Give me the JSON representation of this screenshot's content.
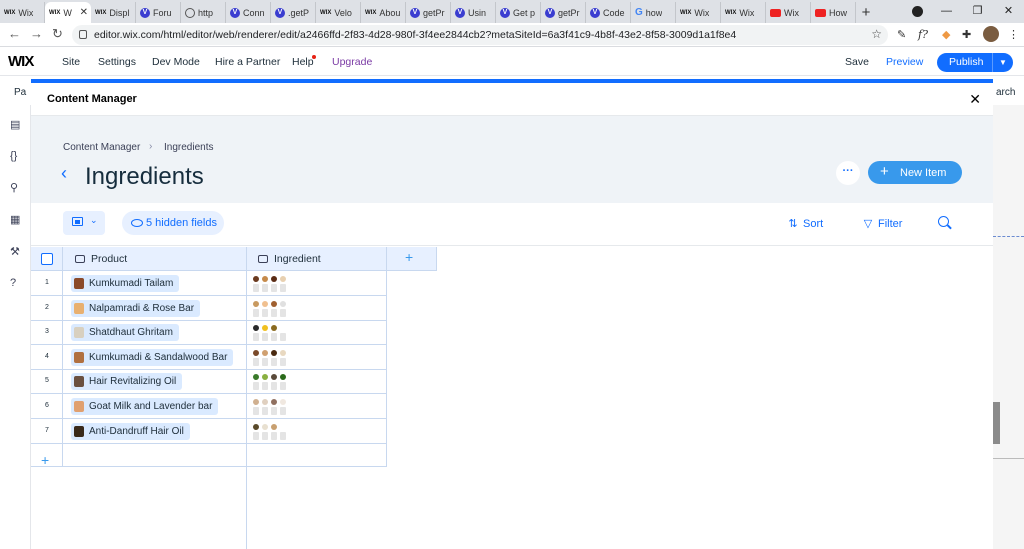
{
  "browser": {
    "tabs": [
      {
        "icon": "wix",
        "label": "Wix"
      },
      {
        "icon": "wix",
        "label": "W",
        "active": true
      },
      {
        "icon": "wix",
        "label": "Displ"
      },
      {
        "icon": "velo",
        "label": "Foru"
      },
      {
        "icon": "globe",
        "label": "http"
      },
      {
        "icon": "velo",
        "label": "Conn"
      },
      {
        "icon": "velo",
        "label": ".getP"
      },
      {
        "icon": "wix",
        "label": "Velo"
      },
      {
        "icon": "wix",
        "label": "Abou"
      },
      {
        "icon": "velo",
        "label": "getPr"
      },
      {
        "icon": "velo",
        "label": "Usin"
      },
      {
        "icon": "velo",
        "label": "Get p"
      },
      {
        "icon": "velo",
        "label": "getPr"
      },
      {
        "icon": "velo",
        "label": "Code"
      },
      {
        "icon": "google",
        "label": "how"
      },
      {
        "icon": "wix",
        "label": "Wix"
      },
      {
        "icon": "wix",
        "label": "Wix"
      },
      {
        "icon": "youtube",
        "label": "Wix"
      },
      {
        "icon": "youtube",
        "label": "How"
      }
    ],
    "url": "editor.wix.com/html/editor/web/renderer/edit/a2466ffd-2f83-4d28-980f-3f4ee2844cb2?metaSiteId=6a3f41c9-4b8f-43e2-8f58-3009d1a1f8e4",
    "accent": "#116dff"
  },
  "editor": {
    "logo": "WIX",
    "menu": [
      "Site",
      "Settings",
      "Dev Mode",
      "Hire a Partner",
      "Help",
      "Upgrade"
    ],
    "save": "Save",
    "preview": "Preview",
    "publish": "Publish",
    "sub_left": "Pa",
    "sub_right": "arch"
  },
  "modal": {
    "title": "Content Manager",
    "breadcrumb": [
      "Content Manager",
      "Ingredients"
    ],
    "page_title": "Ingredients",
    "more": "···",
    "new_item": "New Item",
    "hidden_fields": "5 hidden fields",
    "sort": "Sort",
    "filter": "Filter"
  },
  "table": {
    "columns": [
      "Product",
      "Ingredient"
    ],
    "rows": [
      {
        "num": "1",
        "product": "Kumkumadi Tailam",
        "thumb": "#8a4a2a"
      },
      {
        "num": "2",
        "product": "Nalpamradi & Rose Bar",
        "thumb": "#e8b070"
      },
      {
        "num": "3",
        "product": "Shatdhaut Ghritam",
        "thumb": "#d8d0c0"
      },
      {
        "num": "4",
        "product": "Kumkumadi & Sandalwood Bar",
        "thumb": "#b07040"
      },
      {
        "num": "5",
        "product": "Hair Revitalizing Oil",
        "thumb": "#6a5040"
      },
      {
        "num": "6",
        "product": "Goat Milk and Lavender bar",
        "thumb": "#e0a070"
      },
      {
        "num": "7",
        "product": "Anti-Dandruff Hair Oil",
        "thumb": "#3a2a1a"
      }
    ]
  }
}
